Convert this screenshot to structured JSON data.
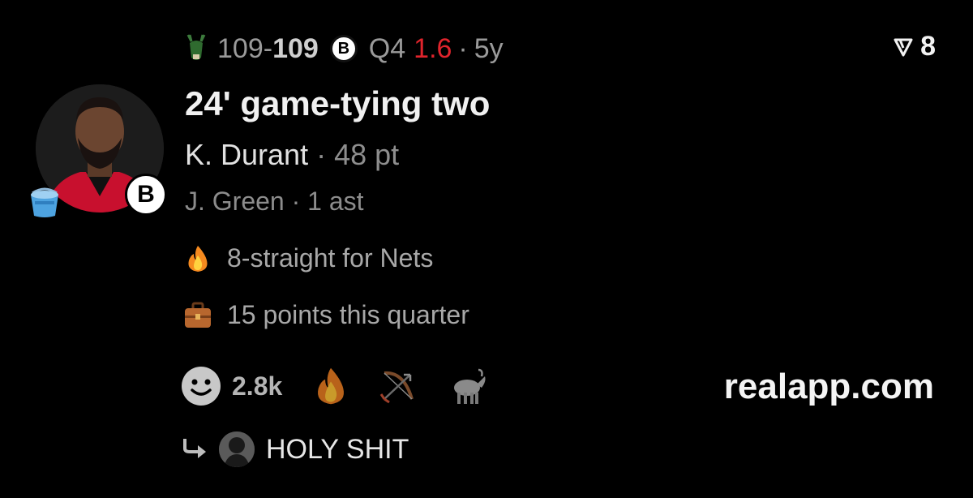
{
  "game": {
    "away_score": "109",
    "home_score": "109",
    "quarter": "Q4",
    "clock": "1.6",
    "age": "5y",
    "away_team_icon": "bucks-deer-icon",
    "home_team_icon": "nets-logo-icon",
    "home_logo_letter": "B"
  },
  "top_right": {
    "icon": "send-arrow-icon",
    "count": "8"
  },
  "play": {
    "headline": "24' game-tying two",
    "player": "K. Durant",
    "player_stat": "48 pt",
    "assist_player": "J. Green",
    "assist_stat": "1 ast"
  },
  "facts": [
    {
      "icon": "fire-icon",
      "text": "8-straight for Nets"
    },
    {
      "icon": "briefcase-icon",
      "text": "15 points this quarter"
    }
  ],
  "reactions": {
    "count": "2.8k",
    "icons": [
      "smiley-face-icon",
      "fire-icon",
      "bow-and-arrow-icon",
      "goat-icon"
    ]
  },
  "brand": "realapp.com",
  "reply": {
    "icon": "reply-arrow-icon",
    "text": "HOLY SHIT"
  },
  "colors": {
    "background": "#000000",
    "clock_red": "#e0242c",
    "text_primary": "#e6e6e6",
    "text_dim": "#8e8e8e"
  }
}
